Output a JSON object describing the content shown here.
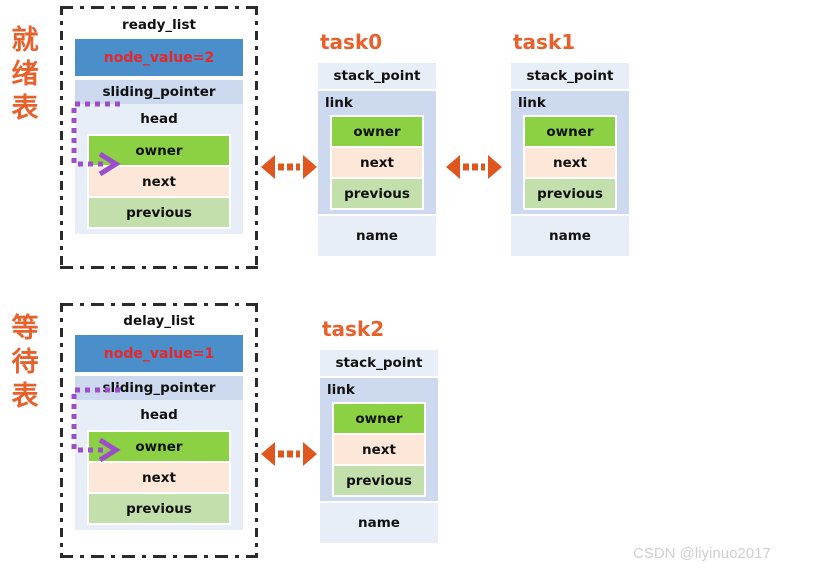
{
  "diagram": {
    "title": "Task list / task control block linkage diagram",
    "colors": {
      "accent_orange": "#e8602c",
      "node_value_bg": "#4a8fc9",
      "node_value_text": "#e8252b",
      "sliding_pointer_bg": "#ccd9ee",
      "head_bg": "#e8eef8",
      "owner_bg": "#8cd143",
      "next_bg": "#fce7d8",
      "previous_bg": "#c3dfab",
      "frame_border": "#2b2b2b",
      "purple_arrow": "#9b4dca",
      "watermark": "#cfcfcf"
    }
  },
  "sections": [
    {
      "cn_label": [
        "就",
        "绪",
        "表"
      ],
      "list": {
        "title": "ready_list",
        "node_value": "node_value=2",
        "sliding_pointer": "sliding_pointer",
        "head": "head",
        "cells": [
          "owner",
          "next",
          "previous"
        ]
      },
      "tasks": [
        {
          "title": "task0",
          "stack_point": "stack_point",
          "link": "link",
          "cells": [
            "owner",
            "next",
            "previous"
          ],
          "name": "name"
        },
        {
          "title": "task1",
          "stack_point": "stack_point",
          "link": "link",
          "cells": [
            "owner",
            "next",
            "previous"
          ],
          "name": "name"
        }
      ]
    },
    {
      "cn_label": [
        "等",
        "待",
        "表"
      ],
      "list": {
        "title": "delay_list",
        "node_value": "node_value=1",
        "sliding_pointer": "sliding_pointer",
        "head": "head",
        "cells": [
          "owner",
          "next",
          "previous"
        ]
      },
      "tasks": [
        {
          "title": "task2",
          "stack_point": "stack_point",
          "link": "link",
          "cells": [
            "owner",
            "next",
            "previous"
          ],
          "name": "name"
        }
      ]
    }
  ],
  "watermark": "CSDN @liyinuo2017"
}
